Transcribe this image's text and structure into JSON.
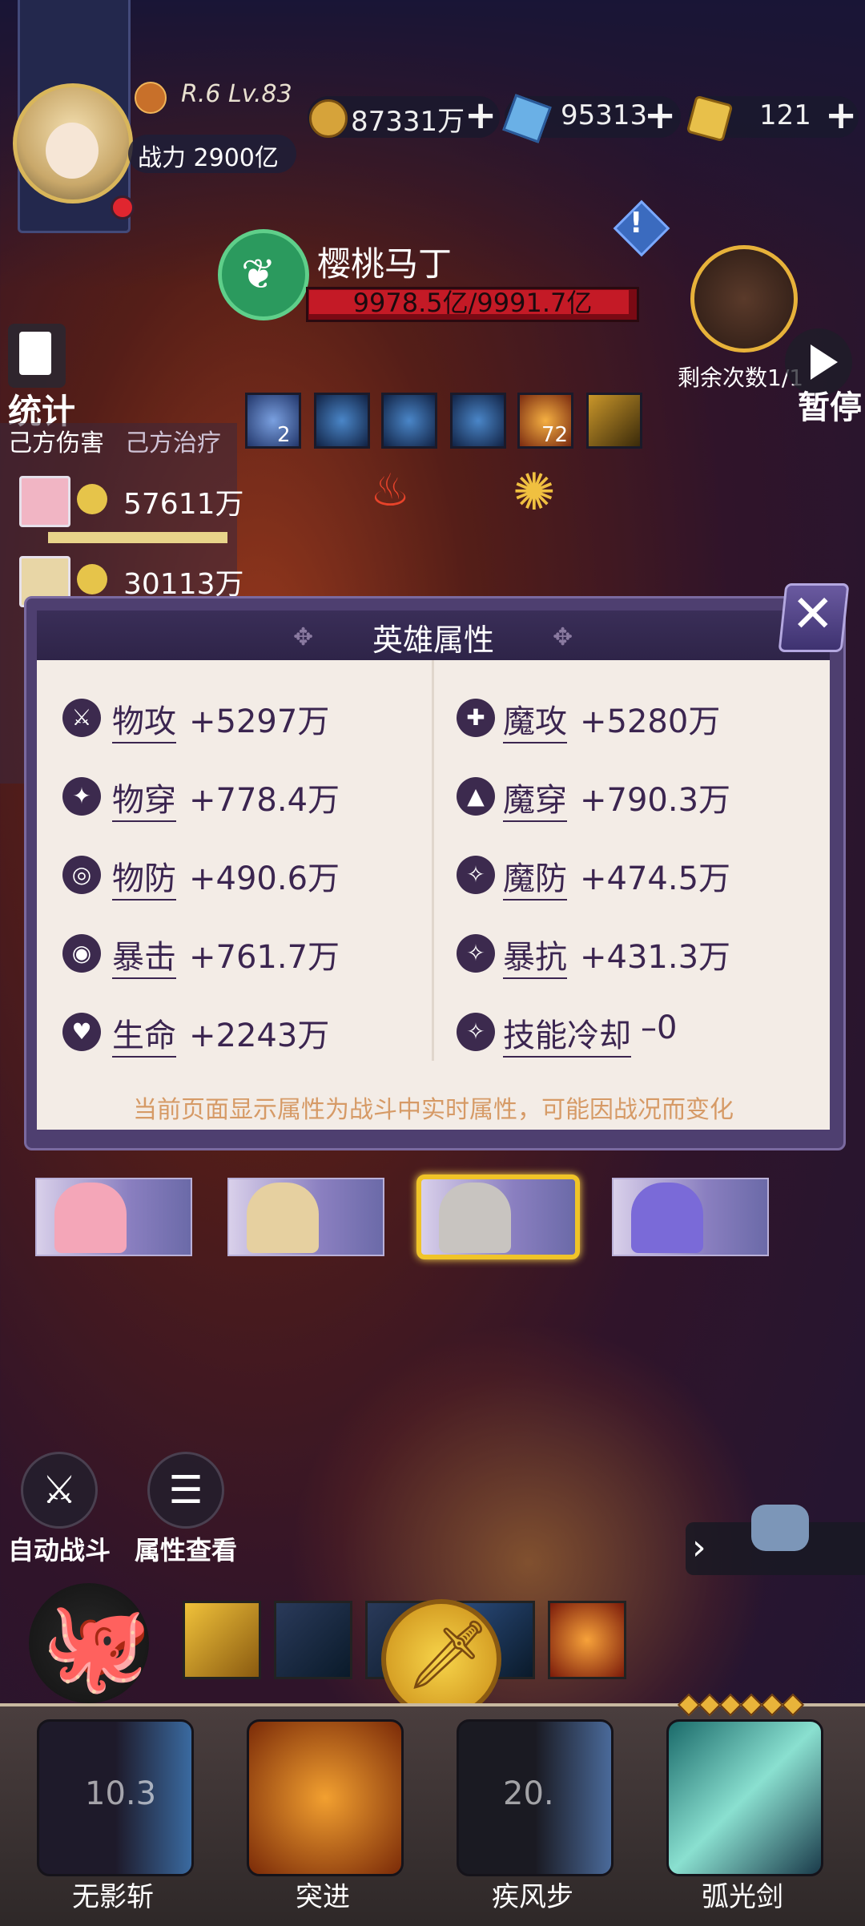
{
  "player": {
    "level": "R.6 Lv.83",
    "power": "战力 2900亿"
  },
  "resources": [
    {
      "icon": "gold-coin-icon",
      "value": "87331万"
    },
    {
      "icon": "blue-gem-icon",
      "value": "95313"
    },
    {
      "icon": "gold-ticket-icon",
      "value": "121"
    }
  ],
  "boss": {
    "name": "樱桃马丁",
    "hp_text": "9978.5亿/9991.7亿",
    "hp_fraction": 0.9987
  },
  "top_right": {
    "remaining": "剩余次数1/1",
    "pause": "暂停"
  },
  "stats_panel": {
    "label": "统计",
    "tab_damage": "己方伤害",
    "tab_heal": "己方治疗",
    "rows": [
      {
        "value": "57611万"
      },
      {
        "value": "30113万"
      }
    ]
  },
  "buffs": [
    {
      "count": "2"
    },
    {
      "count": ""
    },
    {
      "count": ""
    },
    {
      "count": ""
    },
    {
      "count": "72"
    },
    {
      "count": ""
    }
  ],
  "modal": {
    "title": "英雄属性",
    "left": [
      {
        "name": "物攻",
        "value": "+5297万"
      },
      {
        "name": "物穿",
        "value": "+778.4万"
      },
      {
        "name": "物防",
        "value": "+490.6万"
      },
      {
        "name": "暴击",
        "value": "+761.7万"
      },
      {
        "name": "生命",
        "value": "+2243万"
      }
    ],
    "right": [
      {
        "name": "魔攻",
        "value": "+5280万"
      },
      {
        "name": "魔穿",
        "value": "+790.3万"
      },
      {
        "name": "魔防",
        "value": "+474.5万"
      },
      {
        "name": "暴抗",
        "value": "+431.3万"
      },
      {
        "name": "技能冷却",
        "value": "–0"
      }
    ],
    "note": "当前页面显示属性为战斗中实时属性，可能因战况而变化"
  },
  "controls": {
    "auto_battle": "自动战斗",
    "view_attrs": "属性查看"
  },
  "skills": [
    {
      "name": "无影斩",
      "cooldown": "10.3"
    },
    {
      "name": "突进",
      "cooldown": ""
    },
    {
      "name": "疾风步",
      "cooldown": "20."
    },
    {
      "name": "弧光剑",
      "cooldown": ""
    }
  ],
  "colors": {
    "accent_gold": "#f0c428",
    "modal_text": "#3b2550",
    "note_text": "#d69a66",
    "hp_red": "#c41a26"
  }
}
